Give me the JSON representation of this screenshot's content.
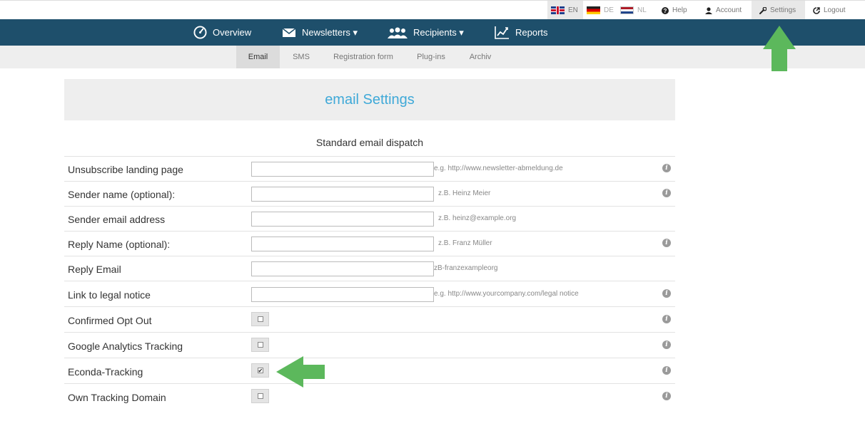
{
  "topbar": {
    "languages": [
      {
        "code": "EN",
        "active": true
      },
      {
        "code": "DE",
        "active": false
      },
      {
        "code": "NL",
        "active": false
      }
    ],
    "help": "Help",
    "account": "Account",
    "settings": "Settings",
    "logout": "Logout"
  },
  "nav": {
    "overview": "Overview",
    "newsletters": "Newsletters ▾",
    "recipients": "Recipients ▾",
    "reports": "Reports"
  },
  "subnav": [
    "Email",
    "SMS",
    "Registration form",
    "Plug-ins",
    "Archiv"
  ],
  "page": {
    "title": "email Settings",
    "section": "Standard email dispatch"
  },
  "fields": [
    {
      "label": "Unsubscribe landing page",
      "value": "",
      "hint": "e.g. http://www.newsletter-abmeldung.de"
    },
    {
      "label": "Sender name (optional):",
      "value": "",
      "hint": "z.B. Heinz Meier"
    },
    {
      "label": "Sender email address",
      "value": "",
      "hint": "z.B. heinz@example.org"
    },
    {
      "label": "Reply Name (optional):",
      "value": "",
      "hint": "z.B. Franz Müller"
    },
    {
      "label": "Reply Email",
      "value": "",
      "hint": "zB-franzexampleorg"
    },
    {
      "label": "Link to legal notice",
      "value": "",
      "hint": "e.g. http://www.yourcompany.com/legal notice"
    }
  ],
  "checkboxes": [
    {
      "label": "Confirmed Opt Out",
      "checked": false
    },
    {
      "label": "Google Analytics Tracking",
      "checked": false
    },
    {
      "label": "Econda-Tracking",
      "checked": true
    },
    {
      "label": "Own Tracking Domain",
      "checked": false
    }
  ],
  "icons": {
    "info": "i",
    "checkmark": "✔"
  },
  "colors": {
    "nav_bg": "#1e4f6b",
    "title_accent": "#3fa9d8",
    "arrow_green": "#5cb85c"
  }
}
